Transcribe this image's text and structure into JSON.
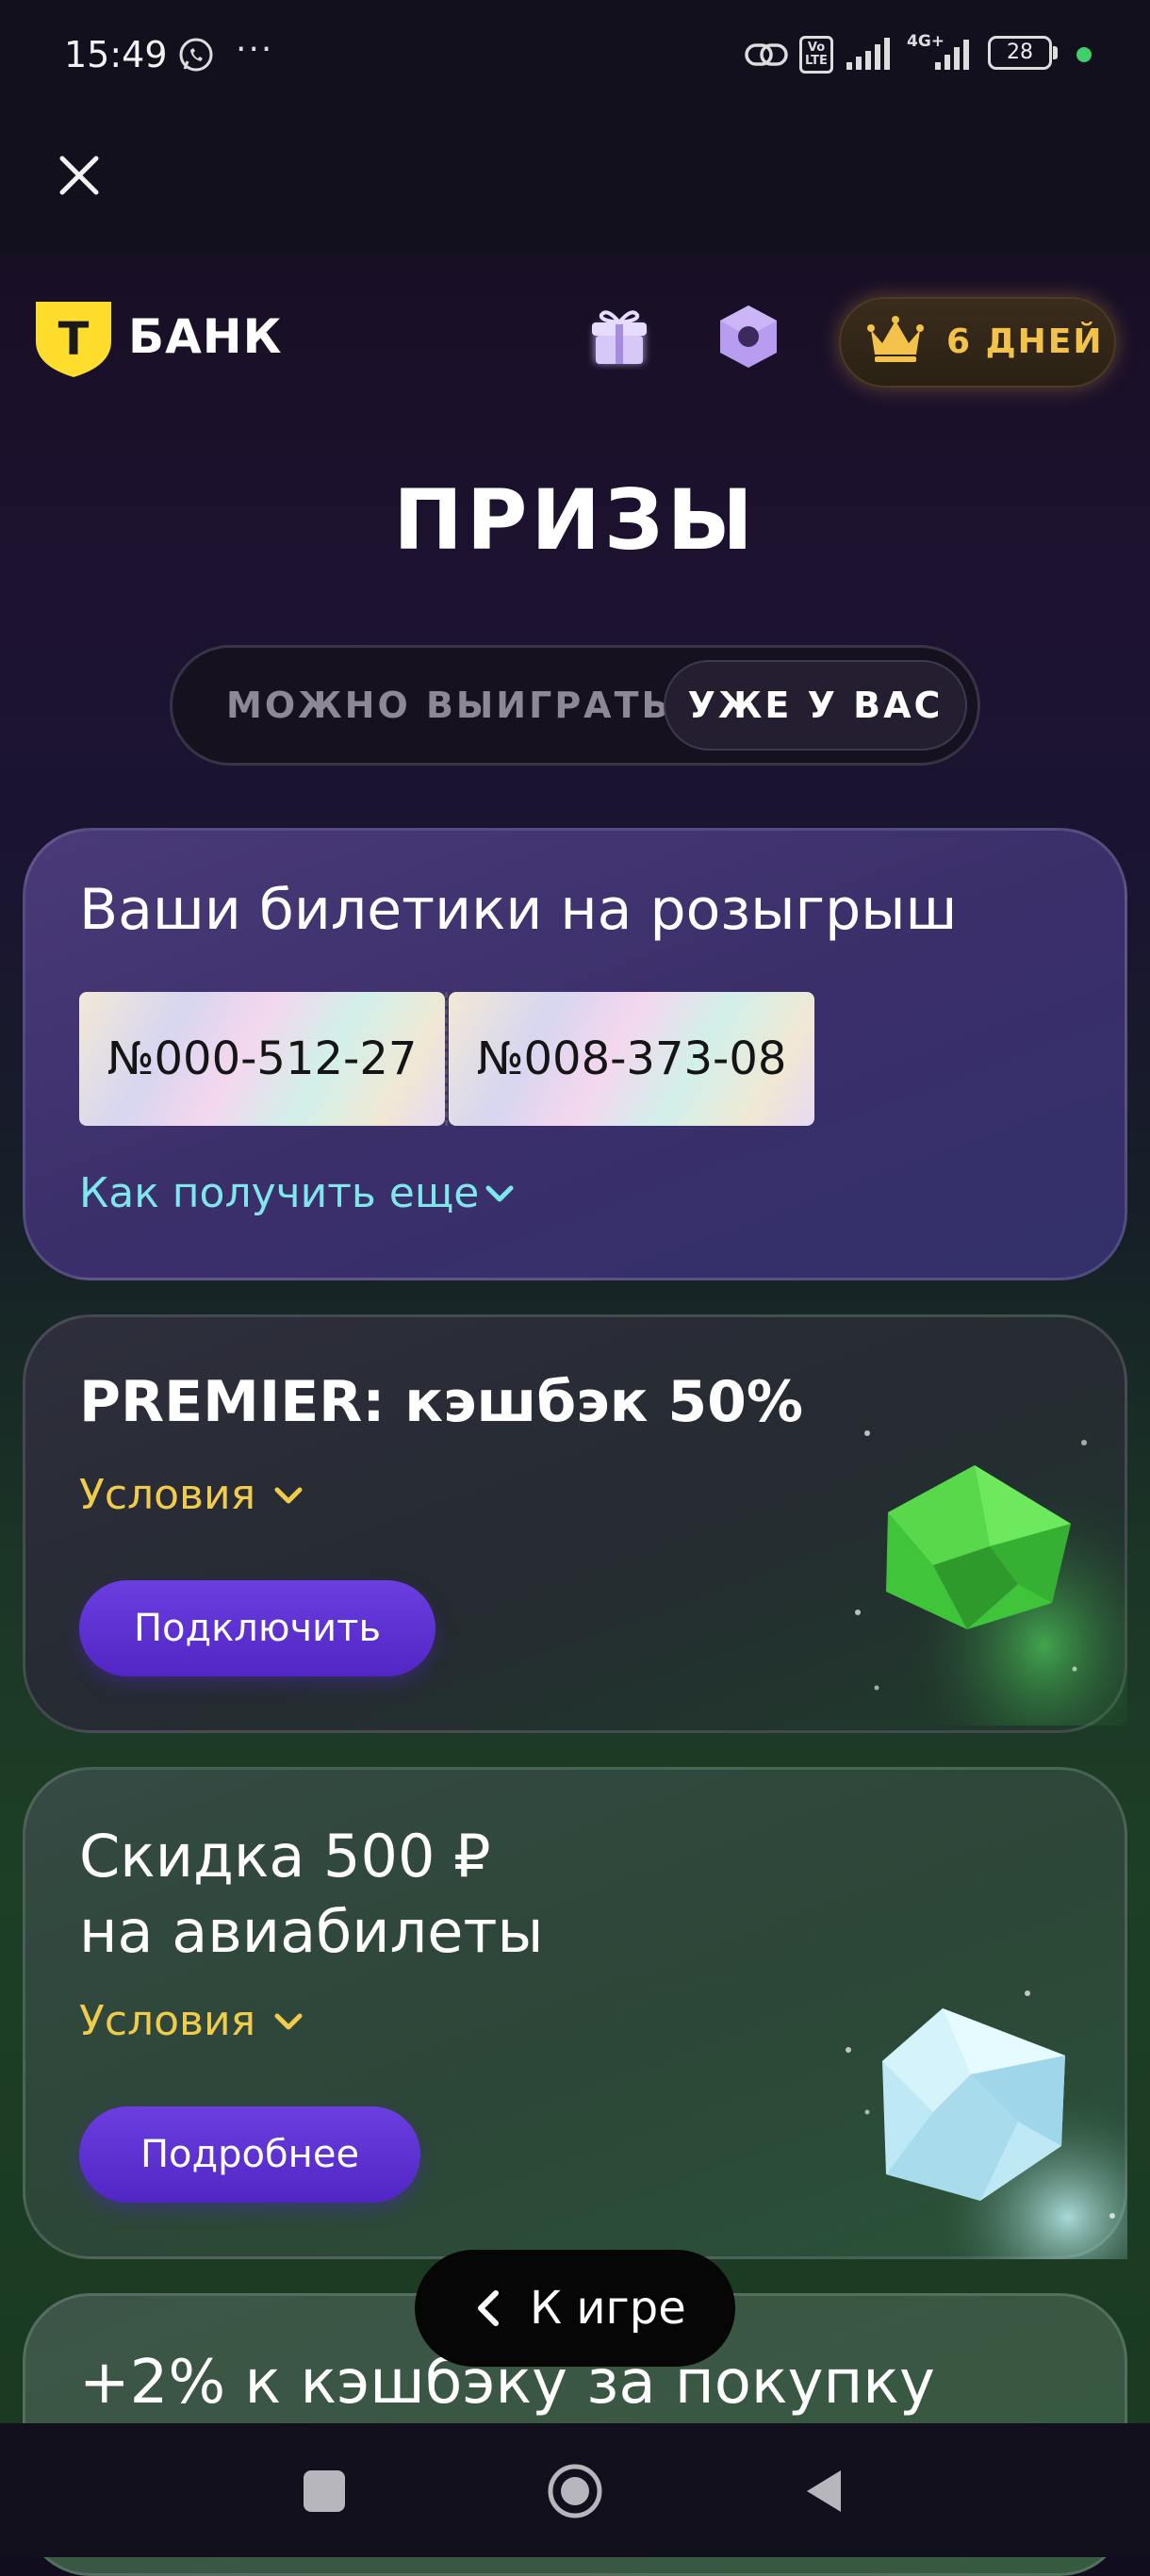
{
  "status_bar": {
    "time": "15:49",
    "more": "···",
    "net_label": "4G+",
    "volte_label": "Vo LTE",
    "battery": "28"
  },
  "header": {
    "logo_letter": "Т",
    "logo_text": "БАНК",
    "days_label": "6 ДНЕЙ"
  },
  "page": {
    "title": "ПРИЗЫ"
  },
  "tabs": {
    "can_win": "МОЖНО ВЫИГРАТЬ",
    "have": "УЖЕ У ВАС",
    "active": "have"
  },
  "tickets_card": {
    "title": "Ваши билетики на розыгрыш",
    "tickets": [
      "№000-512-27",
      "№008-373-08"
    ],
    "how_more": "Как получить еще"
  },
  "premier_card": {
    "title": "PREMIER: кэшбэк 50%",
    "conditions": "Условия",
    "button": "Подключить"
  },
  "avia_card": {
    "title_line1": "Скидка 500 ₽",
    "title_line2": "на авиабилеты",
    "conditions": "Условия",
    "button": "Подробнее"
  },
  "cashback_card": {
    "title": "+2% к кэшбэку за покупку"
  },
  "back_button": {
    "label": "К игре"
  },
  "colors": {
    "accent_gold": "#f0cc4a",
    "link_cyan": "#7fe7ec",
    "button_purple": "#5a2dd0",
    "logo_yellow": "#ffdd2d"
  }
}
